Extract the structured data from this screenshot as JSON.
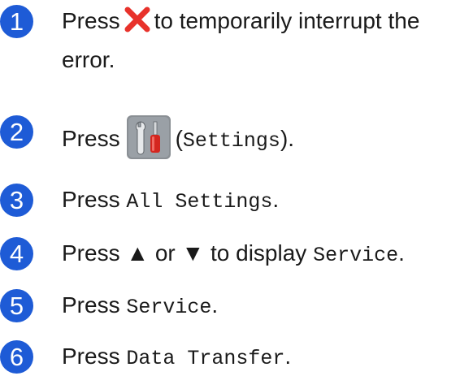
{
  "steps": [
    {
      "number": "1",
      "parts": {
        "a": "Press",
        "icon": "red-x-stop-icon",
        "b": "to temporarily interrupt the",
        "c": "error."
      }
    },
    {
      "number": "2",
      "parts": {
        "a": "Press",
        "icon": "settings-tools-icon",
        "b": "(",
        "code": "Settings",
        "c": ")."
      }
    },
    {
      "number": "3",
      "parts": {
        "a": "Press",
        "code": "All Settings",
        "c": "."
      }
    },
    {
      "number": "4",
      "parts": {
        "a": "Press ▲ or ▼ to display",
        "code": "Service",
        "c": "."
      }
    },
    {
      "number": "5",
      "parts": {
        "a": "Press",
        "code": "Service",
        "c": "."
      }
    },
    {
      "number": "6",
      "parts": {
        "a": "Press",
        "code": "Data Transfer",
        "c": "."
      }
    }
  ],
  "colors": {
    "step_badge": "#1e5bd6",
    "stop_icon": "#e8322b",
    "settings_icon_bg": "#8a8f94"
  }
}
